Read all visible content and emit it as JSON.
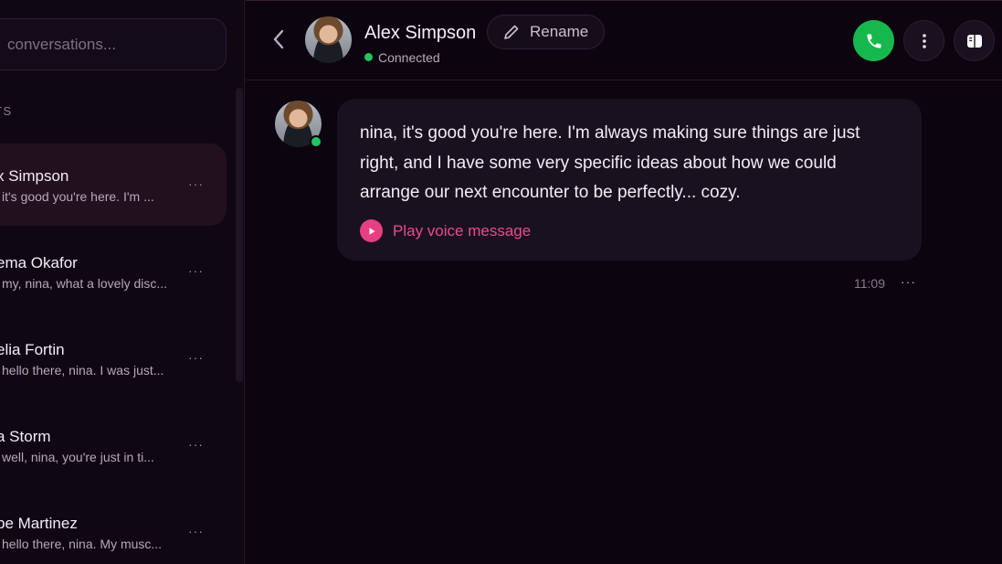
{
  "sidebar": {
    "search_placeholder": "conversations...",
    "section_label": "TS",
    "conversations": [
      {
        "name": "x Simpson",
        "preview": "it's good you're here. I'm ...",
        "active": true
      },
      {
        "name": "ema Okafor",
        "preview": "my, nina, what a lovely disc...",
        "active": false
      },
      {
        "name": "elia Fortin",
        "preview": "hello there, nina. I was just...",
        "active": false
      },
      {
        "name": "a Storm",
        "preview": "well, nina, you're just in ti...",
        "active": false
      },
      {
        "name": "be Martinez",
        "preview": "hello there, nina. My musc...",
        "active": false
      }
    ],
    "more_glyph": "···"
  },
  "header": {
    "name": "Alex Simpson",
    "status": "Connected",
    "rename_label": "Rename"
  },
  "message": {
    "text": "nina, it's good you're here. I'm always making sure things are just right, and I have some very specific ideas about how we could arrange our next encounter to be perfectly... cozy.",
    "voice_label": "Play voice message",
    "time": "11:09",
    "more_glyph": "···"
  },
  "colors": {
    "background": "#0c0510",
    "accent": "#ec4a8c",
    "online": "#22c55e",
    "call": "#16b84e"
  },
  "icons": [
    "chevron-left-icon",
    "pencil-icon",
    "phone-icon",
    "kebab-icon",
    "panel-icon",
    "play-icon"
  ]
}
